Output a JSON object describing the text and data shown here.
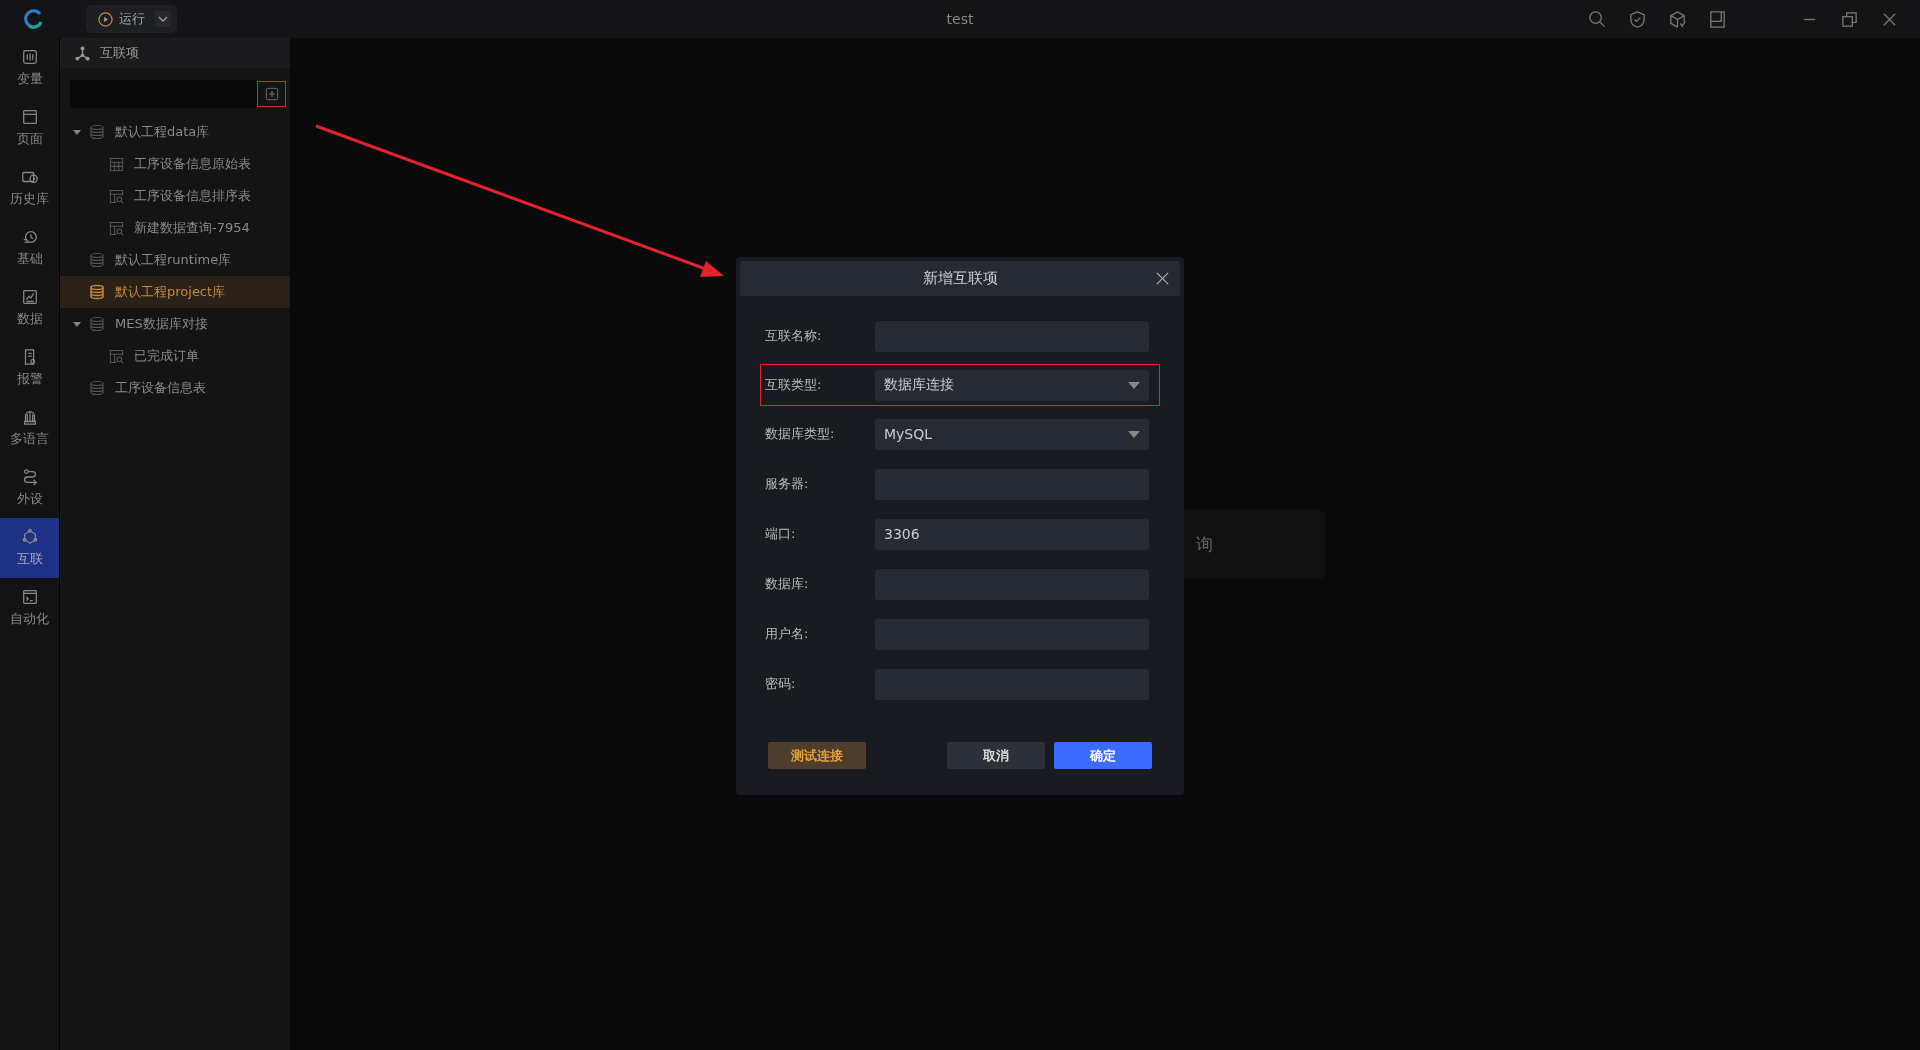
{
  "window": {
    "title": "test"
  },
  "run_button": {
    "label": "运行"
  },
  "nav": [
    {
      "label": "变量",
      "selected": false
    },
    {
      "label": "页面",
      "selected": false
    },
    {
      "label": "历史库",
      "selected": false
    },
    {
      "label": "基础",
      "selected": false
    },
    {
      "label": "数据",
      "selected": false
    },
    {
      "label": "报警",
      "selected": false
    },
    {
      "label": "多语言",
      "selected": false
    },
    {
      "label": "外设",
      "selected": false
    },
    {
      "label": "互联",
      "selected": true
    },
    {
      "label": "自动化",
      "selected": false
    }
  ],
  "panel": {
    "title": "互联项",
    "add_highlighted": true,
    "tree": [
      {
        "label": "默认工程data库",
        "kind": "database",
        "selected": false,
        "expanded": true,
        "children": [
          {
            "label": "工序设备信息原始表",
            "kind": "table",
            "selected": false
          },
          {
            "label": "工序设备信息排序表",
            "kind": "query",
            "selected": false
          },
          {
            "label": "新建数据查询-7954",
            "kind": "query",
            "selected": false
          }
        ]
      },
      {
        "label": "默认工程runtime库",
        "kind": "database",
        "selected": false
      },
      {
        "label": "默认工程project库",
        "kind": "database",
        "selected": true
      },
      {
        "label": "MES数据库对接",
        "kind": "database",
        "selected": false,
        "expanded": true,
        "children": [
          {
            "label": "已完成订单",
            "kind": "query",
            "selected": false
          }
        ]
      },
      {
        "label": "工序设备信息表",
        "kind": "database",
        "selected": false
      }
    ]
  },
  "background_card": {
    "text": "询"
  },
  "dialog": {
    "title": "新增互联项",
    "fields": [
      {
        "label": "互联名称:",
        "kind": "input",
        "highlighted": false
      },
      {
        "label": "互联类型:",
        "kind": "select",
        "value": "数据库连接",
        "highlighted": true
      },
      {
        "label": "数据库类型:",
        "kind": "select",
        "value": "MySQL",
        "highlighted": false
      },
      {
        "label": "服务器:",
        "kind": "input",
        "highlighted": false
      },
      {
        "label": "端口:",
        "kind": "input",
        "value": "3306",
        "highlighted": false
      },
      {
        "label": "数据库:",
        "kind": "input",
        "highlighted": false
      },
      {
        "label": "用户名:",
        "kind": "input",
        "highlighted": false
      },
      {
        "label": "密码:",
        "kind": "input",
        "highlighted": false
      }
    ],
    "buttons": [
      {
        "label": "测试连接",
        "kind": "test"
      },
      {
        "label": "取消",
        "kind": "cancel"
      },
      {
        "label": "确定",
        "kind": "primary"
      }
    ]
  }
}
